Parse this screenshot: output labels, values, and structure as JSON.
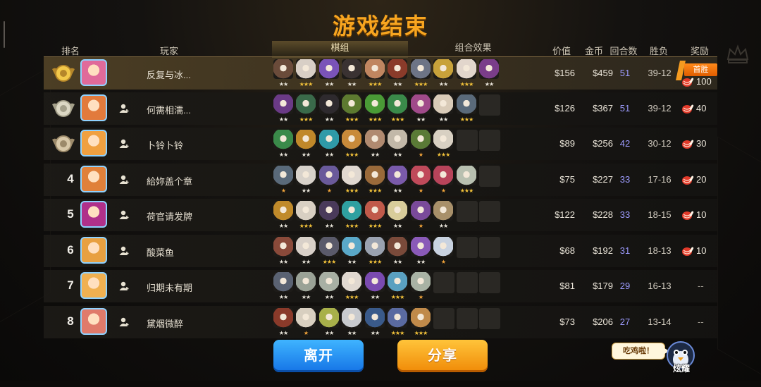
{
  "title": "游戏结束",
  "headers": {
    "rank": "排名",
    "player": "玩家",
    "lineup_tab": "棋组",
    "combo_tab": "组合效果",
    "price": "价值",
    "gold": "金币",
    "rounds": "回合数",
    "winloss": "胜负",
    "reward": "奖励"
  },
  "colors": {
    "title": "#f7a520",
    "rounds": "#9d9cff",
    "first_win_badge": "#f07a10",
    "leave_button": "#1f8ef5",
    "share_button": "#f8a624"
  },
  "rows": [
    {
      "rank_icon": "gold-medal-icon",
      "name": "反复与冰...",
      "friend": false,
      "avatar_color": "#e06a9a",
      "price": "$156",
      "gold": "$459",
      "rounds": "51",
      "winloss": "39-12",
      "reward": "100",
      "first_win": "首胜",
      "pieces": [
        {
          "c": "#6a4b3a",
          "s": 2
        },
        {
          "c": "#d8cfc6",
          "s": 3
        },
        {
          "c": "#7a53b8",
          "s": 2
        },
        {
          "c": "#3a3232",
          "s": 2
        },
        {
          "c": "#c08660",
          "s": 3
        },
        {
          "c": "#8a3b2a",
          "s": 2
        },
        {
          "c": "#6d7486",
          "s": 3
        },
        {
          "c": "#c8a23a",
          "s": 2
        },
        {
          "c": "#e2d6cc",
          "s": 3
        },
        {
          "c": "#7a3d8a",
          "s": 2
        }
      ]
    },
    {
      "rank_icon": "silver-medal-icon",
      "name": "何需相濡...",
      "friend": true,
      "avatar_color": "#e27a3c",
      "price": "$126",
      "gold": "$367",
      "rounds": "51",
      "winloss": "39-12",
      "reward": "40",
      "first_win": "",
      "pieces": [
        {
          "c": "#6a3a86",
          "s": 2
        },
        {
          "c": "#3a6a4a",
          "s": 3
        },
        {
          "c": "#2e2a2e",
          "s": 2
        },
        {
          "c": "#5d7a30",
          "s": 3
        },
        {
          "c": "#4a9a36",
          "s": 3
        },
        {
          "c": "#3a8a4a",
          "s": 3
        },
        {
          "c": "#a04a8a",
          "s": 2
        },
        {
          "c": "#d9cbb8",
          "s": 2
        },
        {
          "c": "#5a6a7a",
          "s": 3
        }
      ]
    },
    {
      "rank_icon": "bronze-medal-icon",
      "name": "卜铃卜铃",
      "friend": true,
      "avatar_color": "#f0a040",
      "price": "$89",
      "gold": "$256",
      "rounds": "42",
      "winloss": "30-12",
      "reward": "30",
      "first_win": "",
      "pieces": [
        {
          "c": "#3a8a4a",
          "s": 2
        },
        {
          "c": "#c0882a",
          "s": 2
        },
        {
          "c": "#2f9aa8",
          "s": 2
        },
        {
          "c": "#c88a3a",
          "s": 3
        },
        {
          "c": "#b08a70",
          "s": 2
        },
        {
          "c": "#c2b8a8",
          "s": 2
        },
        {
          "c": "#5a7a36",
          "s": 1
        },
        {
          "c": "#d8d0c2",
          "s": 3
        }
      ]
    },
    {
      "rank": "4",
      "name": "給妳盖个章",
      "friend": true,
      "avatar_color": "#e0803a",
      "price": "$75",
      "gold": "$227",
      "rounds": "33",
      "winloss": "17-16",
      "reward": "20",
      "first_win": "",
      "pieces": [
        {
          "c": "#5a6a7a",
          "s": 1
        },
        {
          "c": "#d8d2ca",
          "s": 2
        },
        {
          "c": "#6a5a9a",
          "s": 1
        },
        {
          "c": "#e0d8d0",
          "s": 3
        },
        {
          "c": "#9a6a3a",
          "s": 3
        },
        {
          "c": "#7a5aaa",
          "s": 2
        },
        {
          "c": "#c04a5a",
          "s": 1
        },
        {
          "c": "#b8445a",
          "s": 1
        },
        {
          "c": "#b8c0b0",
          "s": 3
        }
      ]
    },
    {
      "rank": "5",
      "name": "荷官请发牌",
      "friend": true,
      "avatar_color": "#b0308a",
      "price": "$122",
      "gold": "$228",
      "rounds": "33",
      "winloss": "18-15",
      "reward": "10",
      "first_win": "",
      "pieces": [
        {
          "c": "#c08a2a",
          "s": 2
        },
        {
          "c": "#d8cfc2",
          "s": 3
        },
        {
          "c": "#4a3a5a",
          "s": 2
        },
        {
          "c": "#2fa0a0",
          "s": 3
        },
        {
          "c": "#c05a4a",
          "s": 3
        },
        {
          "c": "#d8cc9a",
          "s": 2
        },
        {
          "c": "#7a4a9a",
          "s": 1
        },
        {
          "c": "#a8906a",
          "s": 2
        }
      ]
    },
    {
      "rank": "6",
      "name": "酸菜鱼",
      "friend": true,
      "avatar_color": "#e8a040",
      "price": "$68",
      "gold": "$192",
      "rounds": "31",
      "winloss": "18-13",
      "reward": "10",
      "first_win": "",
      "pieces": [
        {
          "c": "#8a4a3a",
          "s": 2
        },
        {
          "c": "#d8d0c8",
          "s": 2
        },
        {
          "c": "#5a5a6a",
          "s": 3
        },
        {
          "c": "#5aa8c8",
          "s": 2
        },
        {
          "c": "#9aa2b0",
          "s": 3
        },
        {
          "c": "#7a4a3a",
          "s": 2
        },
        {
          "c": "#8a5ab8",
          "s": 2
        },
        {
          "c": "#c8d2e0",
          "s": 1
        }
      ]
    },
    {
      "rank": "7",
      "name": "归期未有期",
      "friend": true,
      "avatar_color": "#f0b050",
      "price": "$81",
      "gold": "$179",
      "rounds": "29",
      "winloss": "16-13",
      "reward": "--",
      "first_win": "",
      "pieces": [
        {
          "c": "#5a6272",
          "s": 2
        },
        {
          "c": "#9aa296",
          "s": 2
        },
        {
          "c": "#a8b0a4",
          "s": 2
        },
        {
          "c": "#e0d8d0",
          "s": 3
        },
        {
          "c": "#7a4ab0",
          "s": 2
        },
        {
          "c": "#5aa0c0",
          "s": 3
        },
        {
          "c": "#a8b2a4",
          "s": 1
        }
      ]
    },
    {
      "rank": "8",
      "name": "黛烟微醉",
      "friend": true,
      "avatar_color": "#e07a6a",
      "price": "$73",
      "gold": "$206",
      "rounds": "27",
      "winloss": "13-14",
      "reward": "--",
      "first_win": "",
      "pieces": [
        {
          "c": "#8a3a2a",
          "s": 2
        },
        {
          "c": "#d8cfc0",
          "s": 1
        },
        {
          "c": "#a8b04a",
          "s": 2
        },
        {
          "c": "#c8cace",
          "s": 2
        },
        {
          "c": "#3a5a8a",
          "s": 2
        },
        {
          "c": "#5a6aa0",
          "s": 3
        },
        {
          "c": "#c08a4a",
          "s": 3
        }
      ]
    }
  ],
  "buttons": {
    "leave": "离开",
    "share": "分享"
  },
  "bubble": "吃鸡啦！",
  "brag_label": "炫耀"
}
